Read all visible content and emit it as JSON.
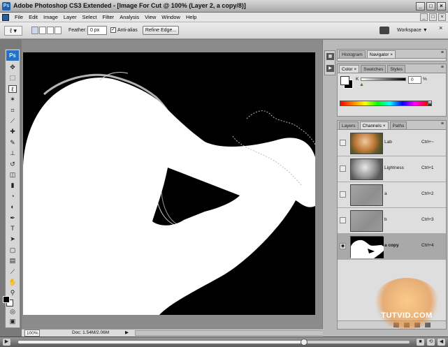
{
  "window": {
    "title": "Adobe Photoshop CS3 Extended - [Image For Cut @ 100% (Layer 2, a copy/8)]",
    "app_mini_logo": "Ps",
    "buttons": [
      "_",
      "□",
      "×"
    ]
  },
  "menu": {
    "items": [
      "File",
      "Edit",
      "Image",
      "Layer",
      "Select",
      "Filter",
      "Analysis",
      "View",
      "Window",
      "Help"
    ],
    "doc_buttons": [
      "_",
      "□",
      "×"
    ]
  },
  "options": {
    "feather_label": "Feather:",
    "feather_value": "0 px",
    "antialias_label": "Anti-alias",
    "antialias_checked": true,
    "refine_edge_label": "Refine Edge...",
    "workspace_label": "Workspace ▼",
    "close": "×"
  },
  "toolbox": {
    "logo": "Ps",
    "tools": [
      {
        "name": "move-tool",
        "glyph": "✥"
      },
      {
        "name": "marquee-tool",
        "glyph": "⬚"
      },
      {
        "name": "lasso-tool",
        "glyph": "ℓ"
      },
      {
        "name": "magic-wand-tool",
        "glyph": "✶"
      },
      {
        "name": "crop-tool",
        "glyph": "⌗"
      },
      {
        "name": "slice-tool",
        "glyph": "⟋"
      },
      {
        "name": "healing-brush-tool",
        "glyph": "✚"
      },
      {
        "name": "brush-tool",
        "glyph": "✎"
      },
      {
        "name": "clone-stamp-tool",
        "glyph": "⊥"
      },
      {
        "name": "history-brush-tool",
        "glyph": "↺"
      },
      {
        "name": "eraser-tool",
        "glyph": "◫"
      },
      {
        "name": "gradient-tool",
        "glyph": "▮"
      },
      {
        "name": "blur-tool",
        "glyph": "◔"
      },
      {
        "name": "dodge-tool",
        "glyph": "◐"
      },
      {
        "name": "pen-tool",
        "glyph": "✒"
      },
      {
        "name": "type-tool",
        "glyph": "T"
      },
      {
        "name": "path-selection-tool",
        "glyph": "➤"
      },
      {
        "name": "shape-tool",
        "glyph": "▢"
      },
      {
        "name": "notes-tool",
        "glyph": "▤"
      },
      {
        "name": "eyedropper-tool",
        "glyph": "⟋"
      },
      {
        "name": "hand-tool",
        "glyph": "✋"
      },
      {
        "name": "zoom-tool",
        "glyph": "⚲"
      }
    ],
    "quick_mask": "◎",
    "screen_mode": "▣"
  },
  "status": {
    "zoom": "100%",
    "doc": "Doc: 1.54M/2.06M",
    "arrow": "▶"
  },
  "panels": {
    "top_tabs": [
      "Histogram",
      "Navigator"
    ],
    "color_tabs": [
      "Color",
      "Swatches",
      "Styles"
    ],
    "k_label": "K",
    "k_value": "0",
    "k_unit": "%",
    "k_level": 0,
    "layer_tabs": [
      "Layers",
      "Channels",
      "Paths"
    ],
    "channels": [
      {
        "name": "Lab",
        "shortcut": "Ctrl+~",
        "thumb": "color",
        "visible": false
      },
      {
        "name": "Lightness",
        "shortcut": "Ctrl+1",
        "thumb": "gray",
        "visible": false
      },
      {
        "name": "a",
        "shortcut": "Ctrl+2",
        "thumb": "flat",
        "visible": false
      },
      {
        "name": "b",
        "shortcut": "Ctrl+3",
        "thumb": "flat",
        "visible": false
      },
      {
        "name": "a copy",
        "shortcut": "Ctrl+4",
        "thumb": "mask",
        "visible": true,
        "selected": true
      }
    ]
  },
  "watermark": "TUTVID.COM",
  "player": {
    "progress": 0.73,
    "buttons": [
      "▶",
      "■",
      "⟲",
      "◀"
    ]
  },
  "colors": {
    "canvas_bg": "#000000",
    "mask_white": "#ffffff",
    "ps_blue": "#2870c2"
  }
}
